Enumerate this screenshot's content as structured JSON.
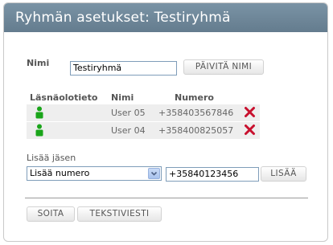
{
  "dialog": {
    "title": "Ryhmän asetukset: Testiryhmä"
  },
  "name_section": {
    "label": "Nimi",
    "value": "Testiryhmä",
    "update_button": "PÄIVITÄ NIMI"
  },
  "members_table": {
    "headers": {
      "presence": "Läsnäolotieto",
      "name": "Nimi",
      "number": "Numero"
    },
    "rows": [
      {
        "presence_icon": "person-online-icon",
        "name": "User 05",
        "number": "+358403567846",
        "delete_icon": "delete-x-icon"
      },
      {
        "presence_icon": "person-online-icon",
        "name": "User 04",
        "number": "+358400825057",
        "delete_icon": "delete-x-icon"
      }
    ]
  },
  "add_member": {
    "label": "Lisää jäsen",
    "select_value": "Lisää numero",
    "number_value": "+35840123456",
    "add_button": "LISÄÄ"
  },
  "footer": {
    "call_button": "SOITA",
    "sms_button": "TEKSTIVIESTI"
  },
  "colors": {
    "titlebar": "#6e8799",
    "presence_online": "#1aa51a",
    "delete": "#c8102e"
  }
}
